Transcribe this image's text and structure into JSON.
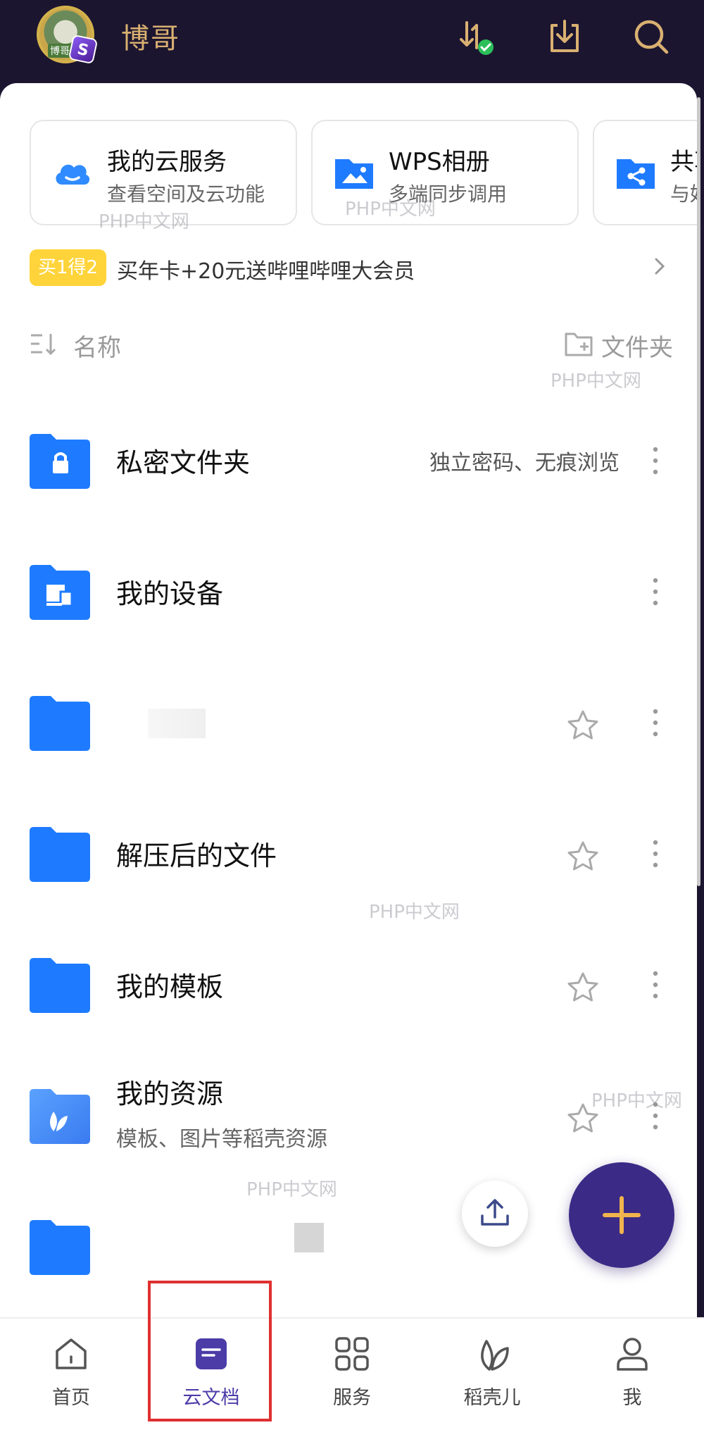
{
  "header": {
    "username": "博哥",
    "avatar_tag": "博哥",
    "avatar_badge": "S",
    "icons": [
      "transfer-sync-icon",
      "download-icon",
      "search-icon"
    ]
  },
  "cards": [
    {
      "title": "我的云服务",
      "subtitle": "查看空间及云功能",
      "icon": "cloud-icon"
    },
    {
      "title": "WPS相册",
      "subtitle": "多端同步调用",
      "icon": "album-folder-icon"
    },
    {
      "title": "共享",
      "subtitle": "与好",
      "icon": "share-folder-icon"
    }
  ],
  "promo": {
    "tag": "买1得2",
    "text": "买年卡+20元送哔哩哔哩大会员"
  },
  "list_header": {
    "sort_label": "名称",
    "new_folder_label": "文件夹"
  },
  "files": [
    {
      "name": "私密文件夹",
      "note": "独立密码、无痕浏览",
      "icon": "lock-folder-icon"
    },
    {
      "name": "我的设备",
      "icon": "device-folder-icon"
    },
    {
      "name": "",
      "icon": "folder-icon"
    },
    {
      "name": "解压后的文件",
      "icon": "folder-icon"
    },
    {
      "name": "我的模板",
      "icon": "folder-icon"
    },
    {
      "name": "我的资源",
      "desc": "模板、图片等稻壳资源",
      "icon": "resource-folder-icon"
    },
    {
      "name": "",
      "icon": "folder-icon"
    }
  ],
  "bottom_nav": [
    {
      "label": "首页",
      "icon": "home-icon"
    },
    {
      "label": "云文档",
      "icon": "cloud-doc-icon",
      "active": true
    },
    {
      "label": "服务",
      "icon": "grid-icon"
    },
    {
      "label": "稻壳儿",
      "icon": "leaf-icon"
    },
    {
      "label": "我",
      "icon": "user-icon"
    }
  ],
  "watermark": "PHP中文网",
  "colors": {
    "header_bg": "#1c1530",
    "accent_gold": "#d9b071",
    "folder_blue": "#1e7bff",
    "fab_purple": "#3b2a86"
  }
}
